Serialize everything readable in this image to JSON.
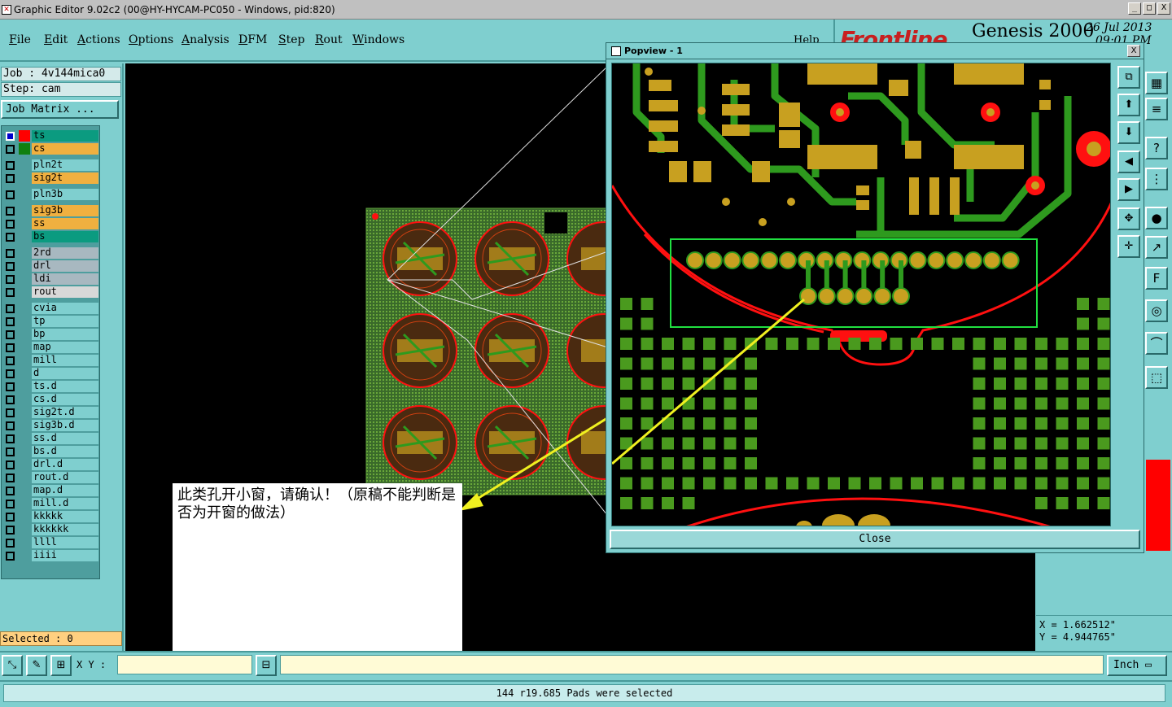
{
  "window": {
    "title": "Graphic Editor 9.02c2 (00@HY-HYCAM-PC050 - Windows, pid:820)",
    "minimize": "_",
    "maximize": "□",
    "close": "X"
  },
  "menu": [
    "File",
    "Edit",
    "Actions",
    "Options",
    "Analysis",
    "DFM",
    "Step",
    "Rout",
    "Windows"
  ],
  "help": "Help",
  "banner": {
    "logo": "Frontline",
    "product": "Genesis 2000",
    "date": "26 Jul 2013",
    "time": "09:01 PM"
  },
  "job": {
    "job_line": "Job : 4v144mica0",
    "step_line": "Step: cam",
    "job_matrix": "Job Matrix ..."
  },
  "layers": [
    {
      "name": "ts",
      "color": "#0b9b80",
      "swatch": "#ff0000",
      "checked": true
    },
    {
      "name": "cs",
      "color": "#f0b040",
      "swatch": "#108010",
      "checked": false
    },
    {
      "name": "pln2t",
      "color": "#7fcfcf",
      "swatch": "",
      "checked": false
    },
    {
      "name": "sig2t",
      "color": "#f0b040",
      "swatch": "",
      "checked": false
    },
    {
      "name": "pln3b",
      "color": "#7fcfcf",
      "swatch": "",
      "checked": false
    },
    {
      "name": "sig3b",
      "color": "#f0b040",
      "swatch": "",
      "checked": false
    },
    {
      "name": "ss",
      "color": "#f0b040",
      "swatch": "",
      "checked": false
    },
    {
      "name": "bs",
      "color": "#0b9b80",
      "swatch": "",
      "checked": false
    },
    {
      "name": "2rd",
      "color": "#a8b8c0",
      "swatch": "",
      "checked": false
    },
    {
      "name": "drl",
      "color": "#a8b8c0",
      "swatch": "",
      "checked": false
    },
    {
      "name": "ldi",
      "color": "#a8b8c0",
      "swatch": "",
      "checked": false
    },
    {
      "name": "rout",
      "color": "#d8d8d8",
      "swatch": "",
      "checked": false
    },
    {
      "name": "cvia",
      "color": "#7fcfcf",
      "swatch": "",
      "checked": false
    },
    {
      "name": "tp",
      "color": "#7fcfcf",
      "swatch": "",
      "checked": false
    },
    {
      "name": "bp",
      "color": "#7fcfcf",
      "swatch": "",
      "checked": false
    },
    {
      "name": "map",
      "color": "#7fcfcf",
      "swatch": "",
      "checked": false
    },
    {
      "name": "mill",
      "color": "#7fcfcf",
      "swatch": "",
      "checked": false
    },
    {
      "name": "d",
      "color": "#7fcfcf",
      "swatch": "",
      "checked": false
    },
    {
      "name": "ts.d",
      "color": "#7fcfcf",
      "swatch": "",
      "checked": false
    },
    {
      "name": "cs.d",
      "color": "#7fcfcf",
      "swatch": "",
      "checked": false
    },
    {
      "name": "sig2t.d",
      "color": "#7fcfcf",
      "swatch": "",
      "checked": false
    },
    {
      "name": "sig3b.d",
      "color": "#7fcfcf",
      "swatch": "",
      "checked": false
    },
    {
      "name": "ss.d",
      "color": "#7fcfcf",
      "swatch": "",
      "checked": false
    },
    {
      "name": "bs.d",
      "color": "#7fcfcf",
      "swatch": "",
      "checked": false
    },
    {
      "name": "drl.d",
      "color": "#7fcfcf",
      "swatch": "",
      "checked": false
    },
    {
      "name": "rout.d",
      "color": "#7fcfcf",
      "swatch": "",
      "checked": false
    },
    {
      "name": "map.d",
      "color": "#7fcfcf",
      "swatch": "",
      "checked": false
    },
    {
      "name": "mill.d",
      "color": "#7fcfcf",
      "swatch": "",
      "checked": false
    },
    {
      "name": "kkkkk",
      "color": "#7fcfcf",
      "swatch": "",
      "checked": false
    },
    {
      "name": "kkkkkk",
      "color": "#7fcfcf",
      "swatch": "",
      "checked": false
    },
    {
      "name": "llll",
      "color": "#7fcfcf",
      "swatch": "",
      "checked": false
    },
    {
      "name": "iiii",
      "color": "#7fcfcf",
      "swatch": "",
      "checked": false
    }
  ],
  "selected": "Selected : 0",
  "xy_label": "X Y :",
  "xy_value": "",
  "coords": {
    "x": "X = 1.662512\"",
    "y": "Y = 4.944765\""
  },
  "unit": "Inch",
  "status": "144 r19.685 Pads were selected",
  "note": "此类孔开小窗，请确认！（原稿不能判断是否为开窗的做法）",
  "popview": {
    "title": "Popview - 1",
    "close_x": "X",
    "close_label": "Close"
  },
  "colors": {
    "board_green": "#4a8a2a",
    "pad_gold": "#c8a020",
    "trace_green": "#2e9a1e",
    "outline_red": "#ff1010",
    "select_green": "#20e040",
    "arrow_yellow": "#f0f020"
  }
}
